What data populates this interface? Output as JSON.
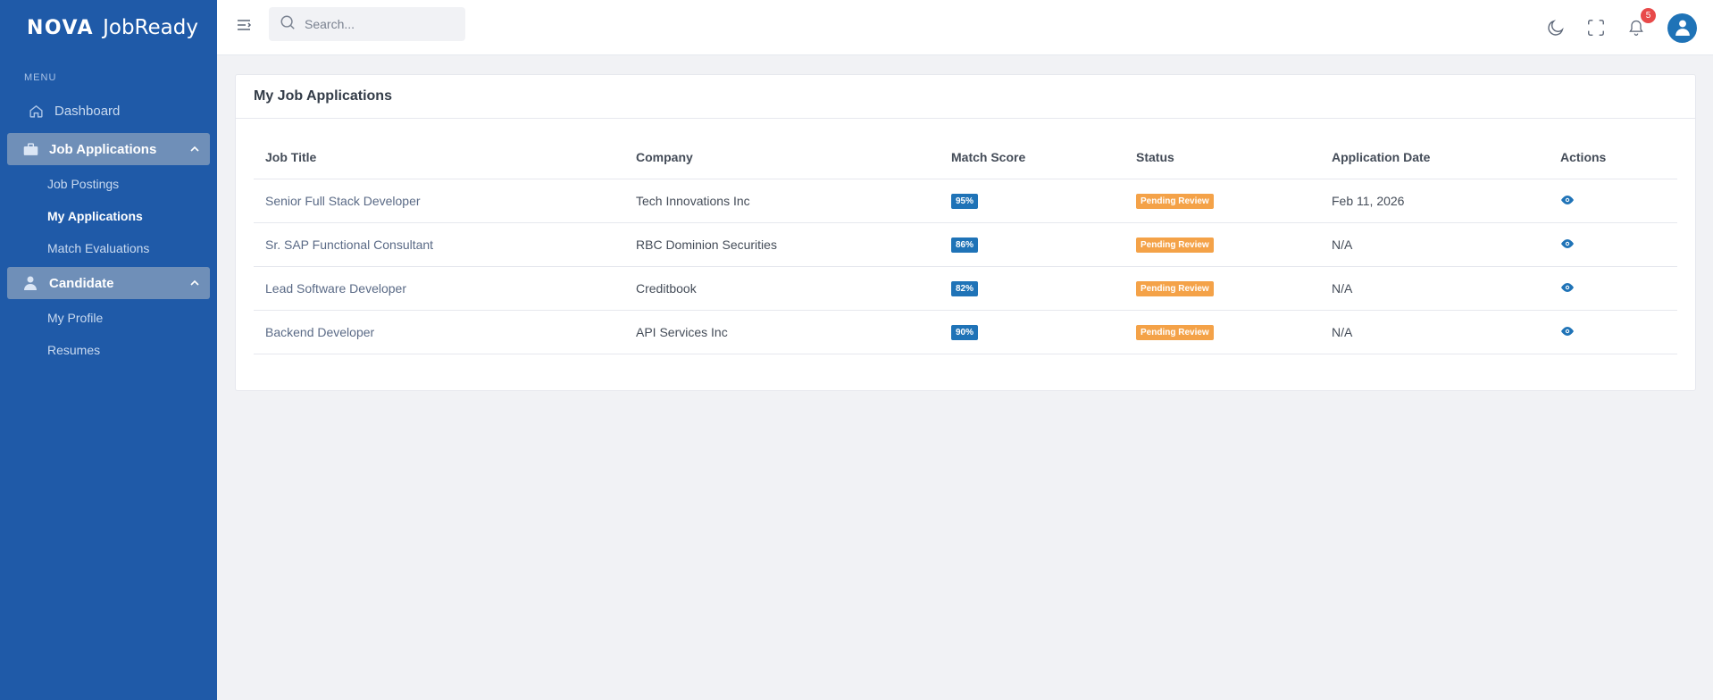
{
  "sidebar": {
    "brand": "NOVA",
    "product": "JobReady",
    "menu_label": "MENU",
    "dashboard": "Dashboard",
    "groups": [
      {
        "label": "Job Applications",
        "icon": "briefcase-icon",
        "items": [
          "Job Postings",
          "My Applications",
          "Match Evaluations"
        ]
      },
      {
        "label": "Candidate",
        "icon": "user-icon",
        "items": [
          "My Profile",
          "Resumes"
        ]
      }
    ]
  },
  "topbar": {
    "search_placeholder": "Search...",
    "notification_count": "5",
    "icons": [
      "menu-icon",
      "search-icon",
      "moon-icon",
      "fullscreen-icon",
      "bell-icon",
      "avatar"
    ]
  },
  "card": {
    "title": "My Job Applications",
    "columns": [
      "Job Title",
      "Company",
      "Match Score",
      "Status",
      "Application Date",
      "Actions"
    ],
    "rows": [
      {
        "title": "Senior Full Stack Developer",
        "company": "Tech Innovations Inc",
        "score": "95%",
        "status": "Pending Review",
        "date": "Feb 11, 2026"
      },
      {
        "title": "Sr. SAP Functional Consultant",
        "company": "RBC Dominion Securities",
        "score": "86%",
        "status": "Pending Review",
        "date": "N/A"
      },
      {
        "title": "Lead Software Developer",
        "company": "Creditbook",
        "score": "82%",
        "status": "Pending Review",
        "date": "N/A"
      },
      {
        "title": "Backend Developer",
        "company": "API Services Inc",
        "score": "90%",
        "status": "Pending Review",
        "date": "N/A"
      }
    ]
  },
  "colors": {
    "sidebar_bg": "#1f5aa8",
    "accent": "#1f73b7",
    "status_pending": "#f4a248",
    "badge": "#e84a4a"
  }
}
